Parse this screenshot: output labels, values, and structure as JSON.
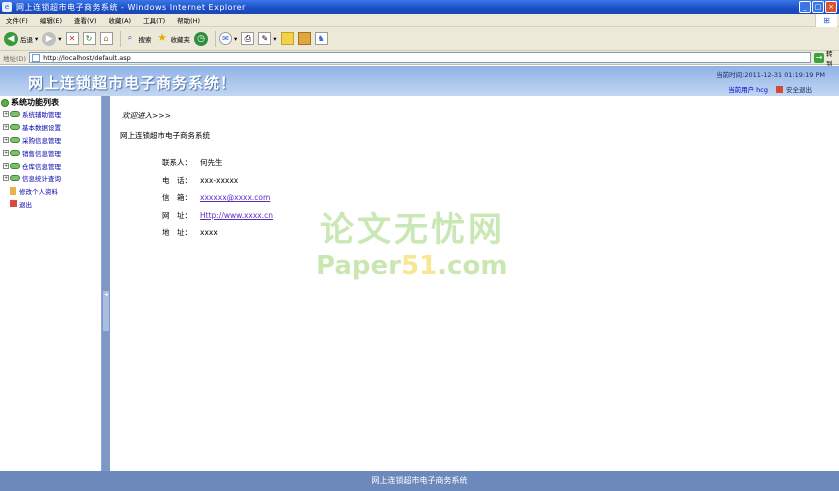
{
  "window": {
    "title": "网上连锁超市电子商务系统 - Windows Internet Explorer",
    "app_logo_glyph": "e",
    "controls": [
      "_",
      "□",
      "×"
    ]
  },
  "menu": [
    "文件(F)",
    "编辑(E)",
    "查看(V)",
    "收藏(A)",
    "工具(T)",
    "帮助(H)"
  ],
  "toolbar": {
    "back_label": "后退",
    "search_label": "搜索",
    "favorites_label": "收藏夹"
  },
  "address": {
    "label": "地址(D)",
    "url": "http://localhost/default.asp",
    "go_label": "转到"
  },
  "header": {
    "title": "网上连锁超市电子商务系统！",
    "time": "当前时间:2011-12-31 01:19:19 PM",
    "current_user": "当前用户 hcg",
    "logout": "安全退出"
  },
  "sidebar": {
    "title": "系统功能列表",
    "items": [
      {
        "label": "系统辅助管理",
        "type": "folder"
      },
      {
        "label": "基本数据设置",
        "type": "folder"
      },
      {
        "label": "采购信息管理",
        "type": "folder"
      },
      {
        "label": "销售信息管理",
        "type": "folder"
      },
      {
        "label": "仓库信息管理",
        "type": "folder"
      },
      {
        "label": "信息统计查询",
        "type": "folder"
      },
      {
        "label": "修改个人资料",
        "type": "leaf"
      },
      {
        "label": "退出",
        "type": "exit"
      }
    ]
  },
  "main": {
    "welcome": "欢迎进入>>>",
    "system_name": "网上连锁超市电子商务系统",
    "contact": [
      {
        "label": "联系人：",
        "value": "何先生"
      },
      {
        "label": "电　话：",
        "value": "xxx-xxxxx"
      },
      {
        "label": "信　箱：",
        "value": "xxxxxx@xxxx.com",
        "link": true
      },
      {
        "label": "网　址：",
        "value": "Http://www.xxxx.cn",
        "link": true
      },
      {
        "label": "地　址：",
        "value": "xxxx"
      }
    ]
  },
  "watermark": {
    "line1": "论文无忧网",
    "line2_a": "Paper",
    "line2_b": "51",
    "line2_c": ".com"
  },
  "footer": "网上连锁超市电子商务系统"
}
